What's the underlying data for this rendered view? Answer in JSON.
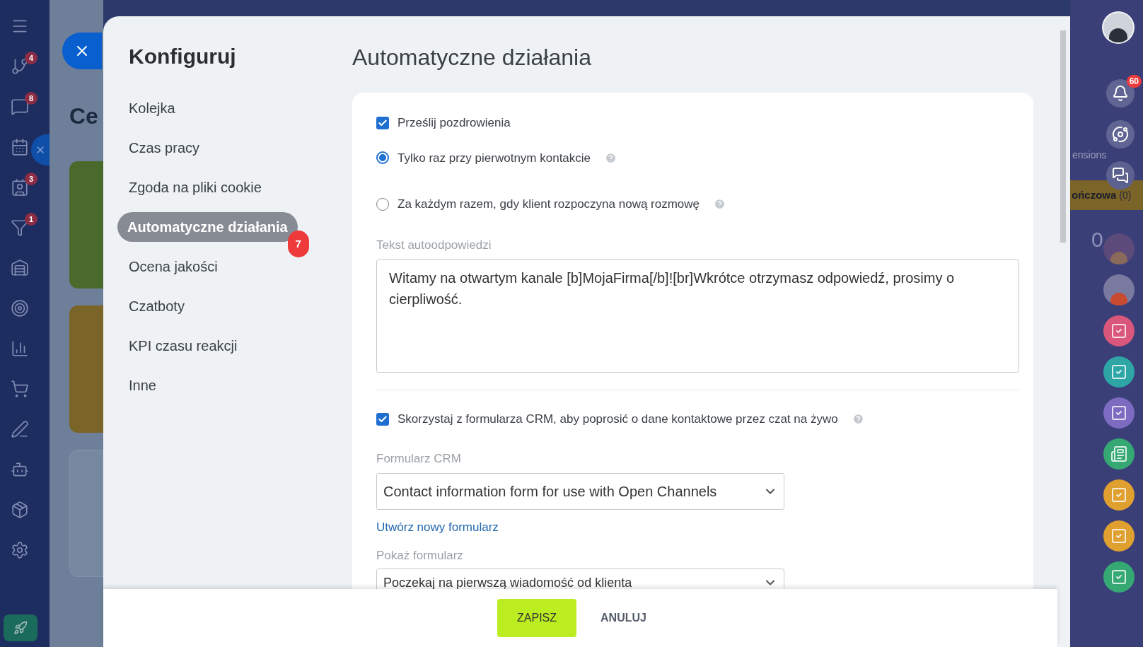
{
  "left_nav": {
    "badges": [
      "4",
      "8",
      "3",
      "1"
    ]
  },
  "background_page": {
    "heading": "Ce",
    "right_fragments": [
      "ensions",
      "ończowa",
      "(0)",
      "0"
    ]
  },
  "right_bar": {
    "notifications_badge": "60",
    "tasks": [
      {
        "color": "#d9577a"
      },
      {
        "color": "#2ea6a6"
      },
      {
        "color": "#7d6bc2"
      },
      {
        "color": "#35a873"
      },
      {
        "color": "#e0a030"
      },
      {
        "color": "#e0a030"
      },
      {
        "color": "#35a873"
      }
    ]
  },
  "panel": {
    "title": "Konfiguruj",
    "menu": [
      {
        "label": "Kolejka",
        "selected": false
      },
      {
        "label": "Czas pracy",
        "selected": false
      },
      {
        "label": "Zgoda na pliki cookie",
        "selected": false
      },
      {
        "label": "Automatyczne działania",
        "selected": true,
        "badge": "7"
      },
      {
        "label": "Ocena jakości",
        "selected": false
      },
      {
        "label": "Czatboty",
        "selected": false
      },
      {
        "label": "KPI czasu reakcji",
        "selected": false
      },
      {
        "label": "Inne",
        "selected": false
      }
    ],
    "heading": "Automatyczne działania",
    "greeting": {
      "label": "Prześlij pozdrowienia",
      "checked": true
    },
    "options": [
      {
        "label": "Tylko raz przy pierwotnym kontakcie",
        "selected": true
      },
      {
        "label": "Za każdym razem, gdy klient rozpoczyna nową rozmowę",
        "selected": false
      }
    ],
    "autoreply": {
      "label": "Tekst autoodpowiedzi",
      "value": "Witamy na otwartym kanale [b]MojaFirma[/b]![br]Wkrótce otrzymasz odpowiedź, prosimy o cierpliwość."
    },
    "crm": {
      "label": "Skorzystaj z formularza CRM, aby poprosić o dane kontaktowe przez czat na żywo",
      "checked": true
    },
    "crm_form": {
      "label": "Formularz CRM",
      "value": "Contact information form for use with Open Channels",
      "link": "Utwórz nowy formularz"
    },
    "show_form": {
      "label": "Pokaż formularz",
      "value": "Poczekaj na pierwszą wiadomość od klienta"
    },
    "buttons": [
      "ZAPISZ",
      "ANULUJ"
    ]
  }
}
